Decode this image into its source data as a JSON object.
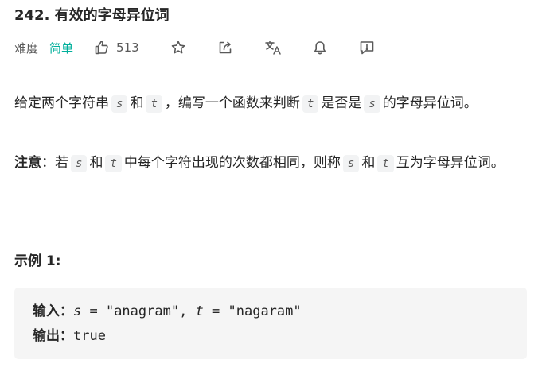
{
  "problem": {
    "title": "242. 有效的字母异位词",
    "difficulty_label": "难度",
    "difficulty_value": "简单",
    "likes": "513",
    "colors": {
      "easy": "#00af9b",
      "text": "#262626",
      "muted": "#595959"
    },
    "icons": [
      "thumbs-up-icon",
      "star-icon",
      "share-icon",
      "translate-icon",
      "bell-icon",
      "feedback-icon"
    ]
  },
  "description": {
    "p1_a": "给定两个字符串",
    "var_s": "s",
    "p1_and": "和",
    "var_t": "t",
    "p1_b": "，编写一个函数来判断",
    "p1_c": "是否是",
    "p1_d": "的字母异位词。",
    "note_label": "注意",
    "note_colon": "：若",
    "note_a": "中每个字符出现的次数都相同，则称",
    "note_b": "互为字母异位词。"
  },
  "example": {
    "title": "示例 1:",
    "input_label": "输入：",
    "input_s_var": "s",
    "input_s_value": " = \"anagram\", ",
    "input_t_var": "t",
    "input_t_value": " = \"nagaram\"",
    "output_label": "输出：",
    "output_value": "true"
  }
}
